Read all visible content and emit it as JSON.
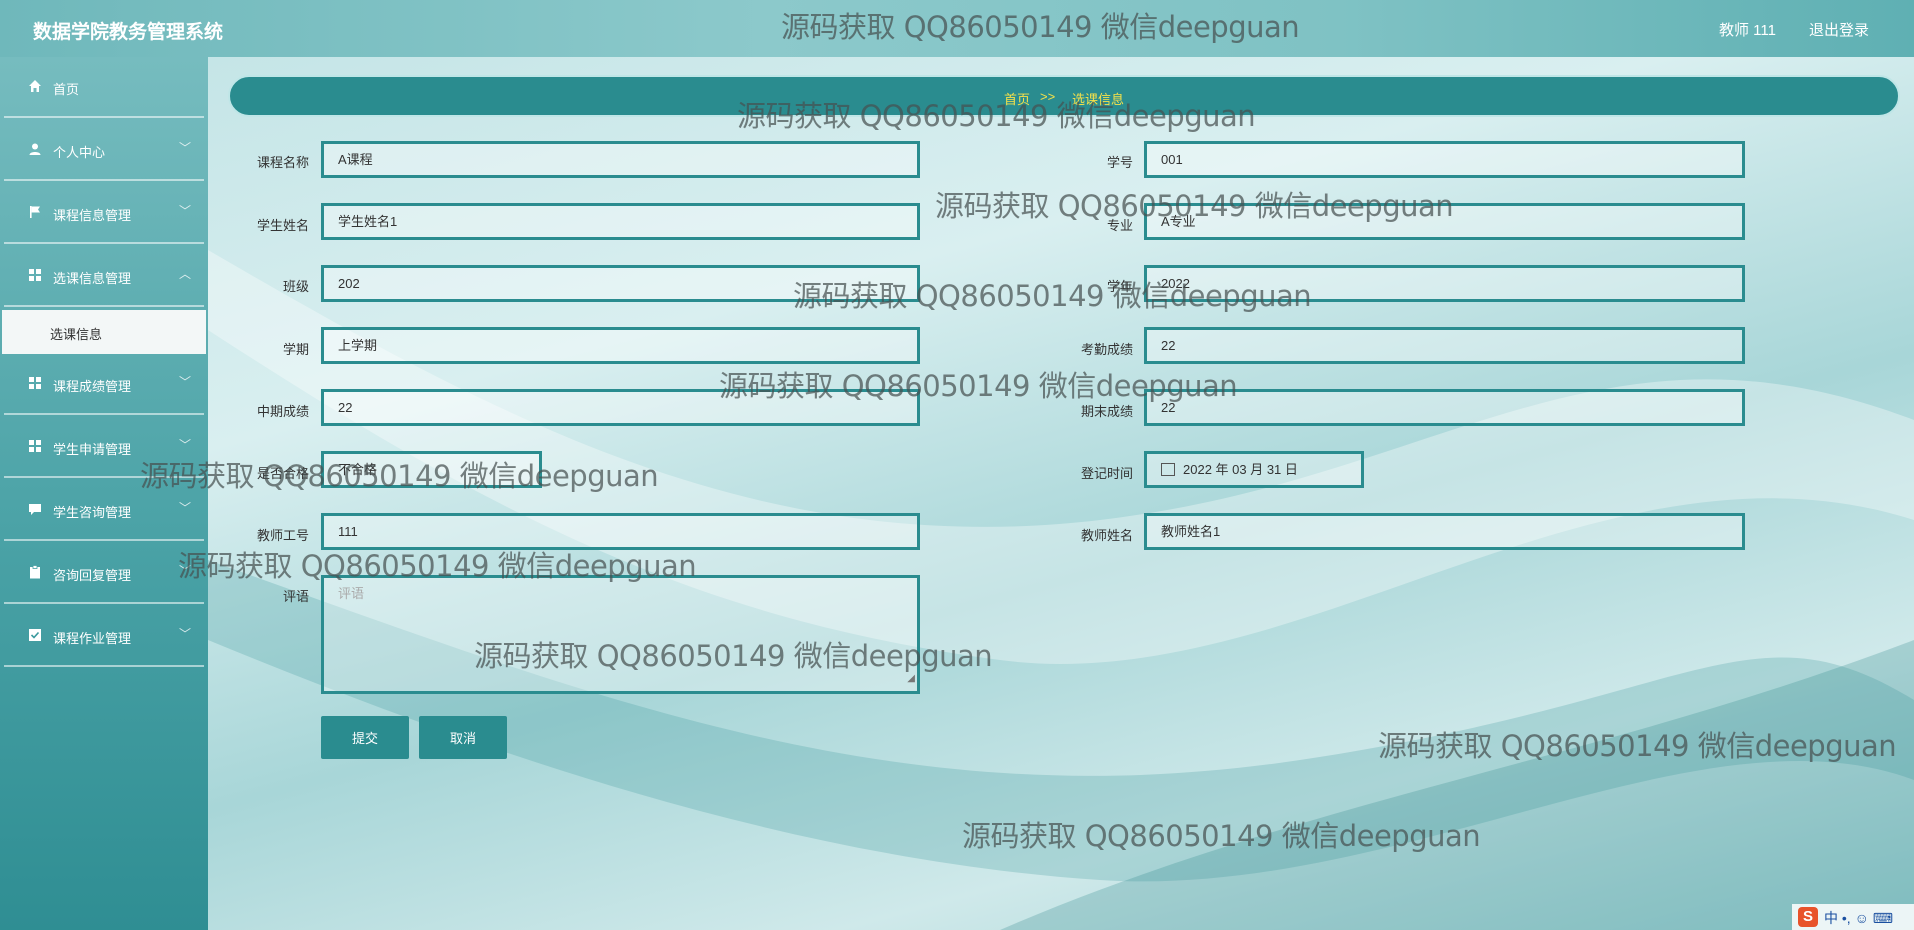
{
  "header": {
    "app_title": "数据学院教务管理系统",
    "user_label": "教师 111",
    "logout_label": "退出登录"
  },
  "sidebar": {
    "items": [
      {
        "label": "首页",
        "icon": "home-icon"
      },
      {
        "label": "个人中心",
        "icon": "user-icon"
      },
      {
        "label": "课程信息管理",
        "icon": "flag-icon"
      },
      {
        "label": "选课信息管理",
        "icon": "grid-icon"
      },
      {
        "label": "课程成绩管理",
        "icon": "grid-icon"
      },
      {
        "label": "学生申请管理",
        "icon": "grid-icon"
      },
      {
        "label": "学生咨询管理",
        "icon": "chat-icon"
      },
      {
        "label": "咨询回复管理",
        "icon": "clipboard-icon"
      },
      {
        "label": "课程作业管理",
        "icon": "check-square-icon"
      }
    ],
    "active_sub": "选课信息"
  },
  "breadcrumb": {
    "home": "首页",
    "sep": ">>",
    "current": "选课信息"
  },
  "form": {
    "course_name_label": "课程名称",
    "course_name": "A课程",
    "student_id_label": "学号",
    "student_id": "001",
    "student_name_label": "学生姓名",
    "student_name": "学生姓名1",
    "major_label": "专业",
    "major": "A专业",
    "class_label": "班级",
    "class": "202",
    "year_label": "学年",
    "year": "2022",
    "term_label": "学期",
    "term": "上学期",
    "attendance_label": "考勤成绩",
    "attendance": "22",
    "midterm_label": "中期成绩",
    "midterm": "22",
    "final_label": "期末成绩",
    "final": "22",
    "passed_label": "是否合格",
    "passed": "不合格",
    "reg_time_label": "登记时间",
    "reg_time": "2022 年 03 月 31 日",
    "teacher_id_label": "教师工号",
    "teacher_id": "111",
    "teacher_name_label": "教师姓名",
    "teacher_name": "教师姓名1",
    "comment_label": "评语",
    "comment_placeholder": "评语",
    "submit_label": "提交",
    "cancel_label": "取消"
  },
  "watermark": "源码获取 QQ86050149 微信deepguan",
  "tray": {
    "ime": "中 •, ☺ ⌨",
    "logo": "S"
  },
  "colors": {
    "accent": "#2a8c8f",
    "crumb_text": "#f5e14a"
  }
}
